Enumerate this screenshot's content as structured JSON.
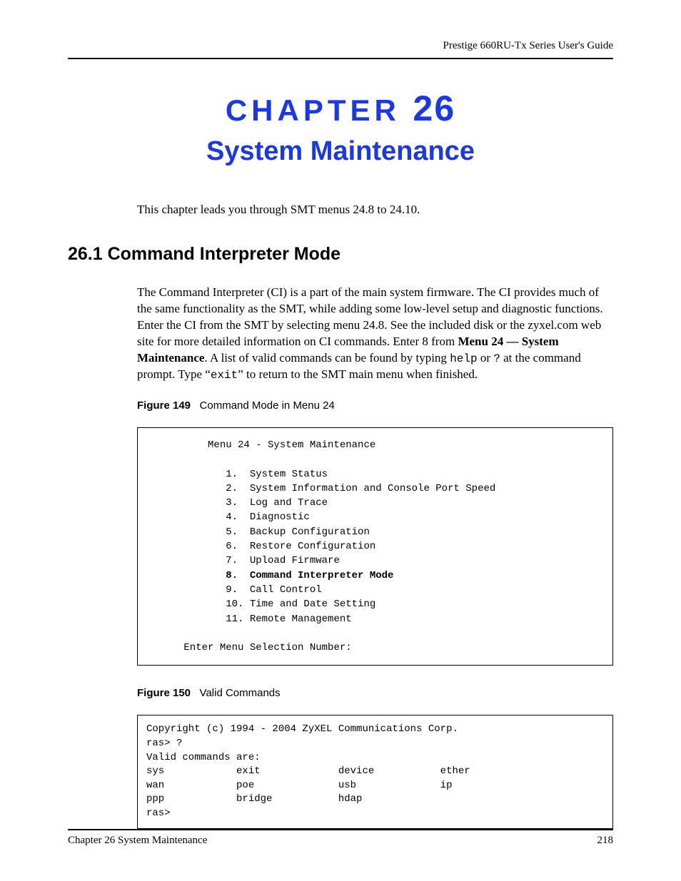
{
  "header": {
    "guide_title": "Prestige 660RU-Tx Series User's Guide"
  },
  "chapter": {
    "label_word": "CHAPTER",
    "number": "26",
    "title": "System Maintenance",
    "intro": "This chapter leads you through SMT menus 24.8 to 24.10."
  },
  "section": {
    "heading": "26.1  Command Interpreter Mode",
    "para_pre": "The Command Interpreter (CI) is a part of the main system firmware. The CI provides much of the same functionality as the SMT, while adding some low-level setup and diagnostic functions. Enter the CI from the SMT by selecting menu 24.8. See the included disk or the zyxel.com web site for more detailed information on CI commands. Enter 8 from ",
    "para_bold": "Menu 24 — System Maintenance",
    "para_mid": ". A list of valid commands can be found by typing ",
    "para_help": "help",
    "para_or": " or ",
    "para_q": "?",
    "para_at": " at the command prompt. Type “",
    "para_exit": "exit",
    "para_end": "” to return to the SMT main menu when finished."
  },
  "figure149": {
    "label": "Figure 149",
    "caption": "Command Mode in Menu 24",
    "menu_title": "Menu 24 - System Maintenance",
    "items": [
      "1.  System Status",
      "2.  System Information and Console Port Speed",
      "3.  Log and Trace",
      "4.  Diagnostic",
      "5.  Backup Configuration",
      "6.  Restore Configuration",
      "7.  Upload Firmware"
    ],
    "item_bold": "8.  Command Interpreter Mode",
    "items_after": [
      "9.  Call Control",
      "10. Time and Date Setting",
      "11. Remote Management"
    ],
    "prompt": "Enter Menu Selection Number:"
  },
  "figure150": {
    "label": "Figure 150",
    "caption": "Valid Commands",
    "line1": "Copyright (c) 1994 - 2004 ZyXEL Communications Corp.",
    "line2": "ras> ?",
    "line3": "Valid commands are:",
    "row1": [
      "sys",
      "exit",
      "device",
      "ether"
    ],
    "row2": [
      "wan",
      "poe",
      "usb",
      "ip"
    ],
    "row3": [
      "ppp",
      "bridge",
      "hdap",
      ""
    ],
    "line_end": "ras>"
  },
  "footer": {
    "left": "Chapter 26 System Maintenance",
    "right": "218"
  }
}
